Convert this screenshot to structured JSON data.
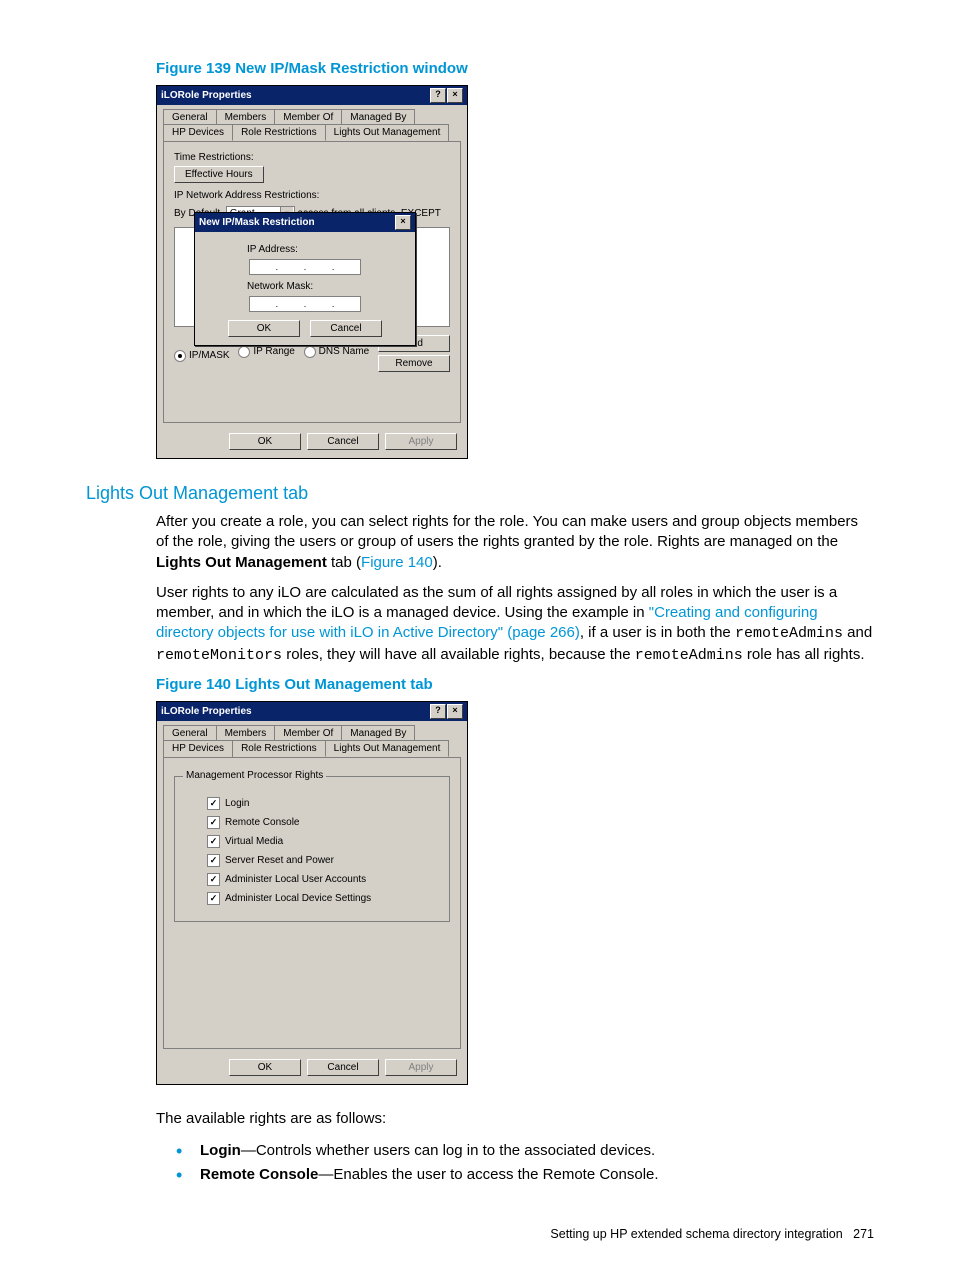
{
  "fig139_caption": "Figure 139 New IP/Mask Restriction window",
  "fig140_caption": "Figure 140 Lights Out Management tab",
  "section_heading": "Lights Out Management tab",
  "para1_a": "After you create a role, you can select rights for the role. You can make users and group objects members of the role, giving the users or group of users the rights granted by the role. Rights are managed on the ",
  "para1_b": "Lights Out Management",
  "para1_c": " tab (",
  "para1_link": "Figure 140",
  "para1_d": ").",
  "para2_a": "User rights to any iLO are calculated as the sum of all rights assigned by all roles in which the user is a member, and in which the iLO is a managed device. Using the example in ",
  "para2_link": "\"Creating and configuring directory objects for use with iLO in Active Directory\" (page 266)",
  "para2_b": ", if a user is in both the ",
  "para2_m1": "remoteAdmins",
  "para2_c": " and ",
  "para2_m2": "remoteMonitors",
  "para2_d": " roles, they will have all available rights, because the ",
  "para2_m3": "remoteAdmins",
  "para2_e": " role has all rights.",
  "rights_intro": "The available rights are as follows:",
  "right_login_t": "Login",
  "right_login_d": "—Controls whether users can log in to the associated devices.",
  "right_rc_t": "Remote Console",
  "right_rc_d": "—Enables the user to access the Remote Console.",
  "footer_text": "Setting up HP extended schema directory integration",
  "footer_page": "271",
  "dlg": {
    "title": "iLORole Properties",
    "help": "?",
    "close": "×",
    "tabs": [
      "General",
      "Members",
      "Member Of",
      "Managed By",
      "HP Devices",
      "Role Restrictions",
      "Lights Out Management"
    ],
    "ok": "OK",
    "cancel": "Cancel",
    "apply": "Apply"
  },
  "restr": {
    "time_label": "Time Restrictions:",
    "eff_hours": "Effective Hours",
    "ip_label": "IP Network Address Restrictions:",
    "by_default": "By Default,",
    "grant": "Grant",
    "except": "access from all clients, EXCEPT",
    "r_ipmask": "IP/MASK",
    "r_iprange": "IP Range",
    "r_dns": "DNS Name",
    "add": "Add",
    "remove": "Remove"
  },
  "modal": {
    "title": "New IP/Mask Restriction",
    "ip": "IP Address:",
    "mask": "Network Mask:",
    "ok": "OK",
    "cancel": "Cancel"
  },
  "mgmt": {
    "group": "Management Processor Rights",
    "c1": "Login",
    "c2": "Remote Console",
    "c3": "Virtual Media",
    "c4": "Server Reset and Power",
    "c5": "Administer Local User Accounts",
    "c6": "Administer Local Device Settings"
  }
}
